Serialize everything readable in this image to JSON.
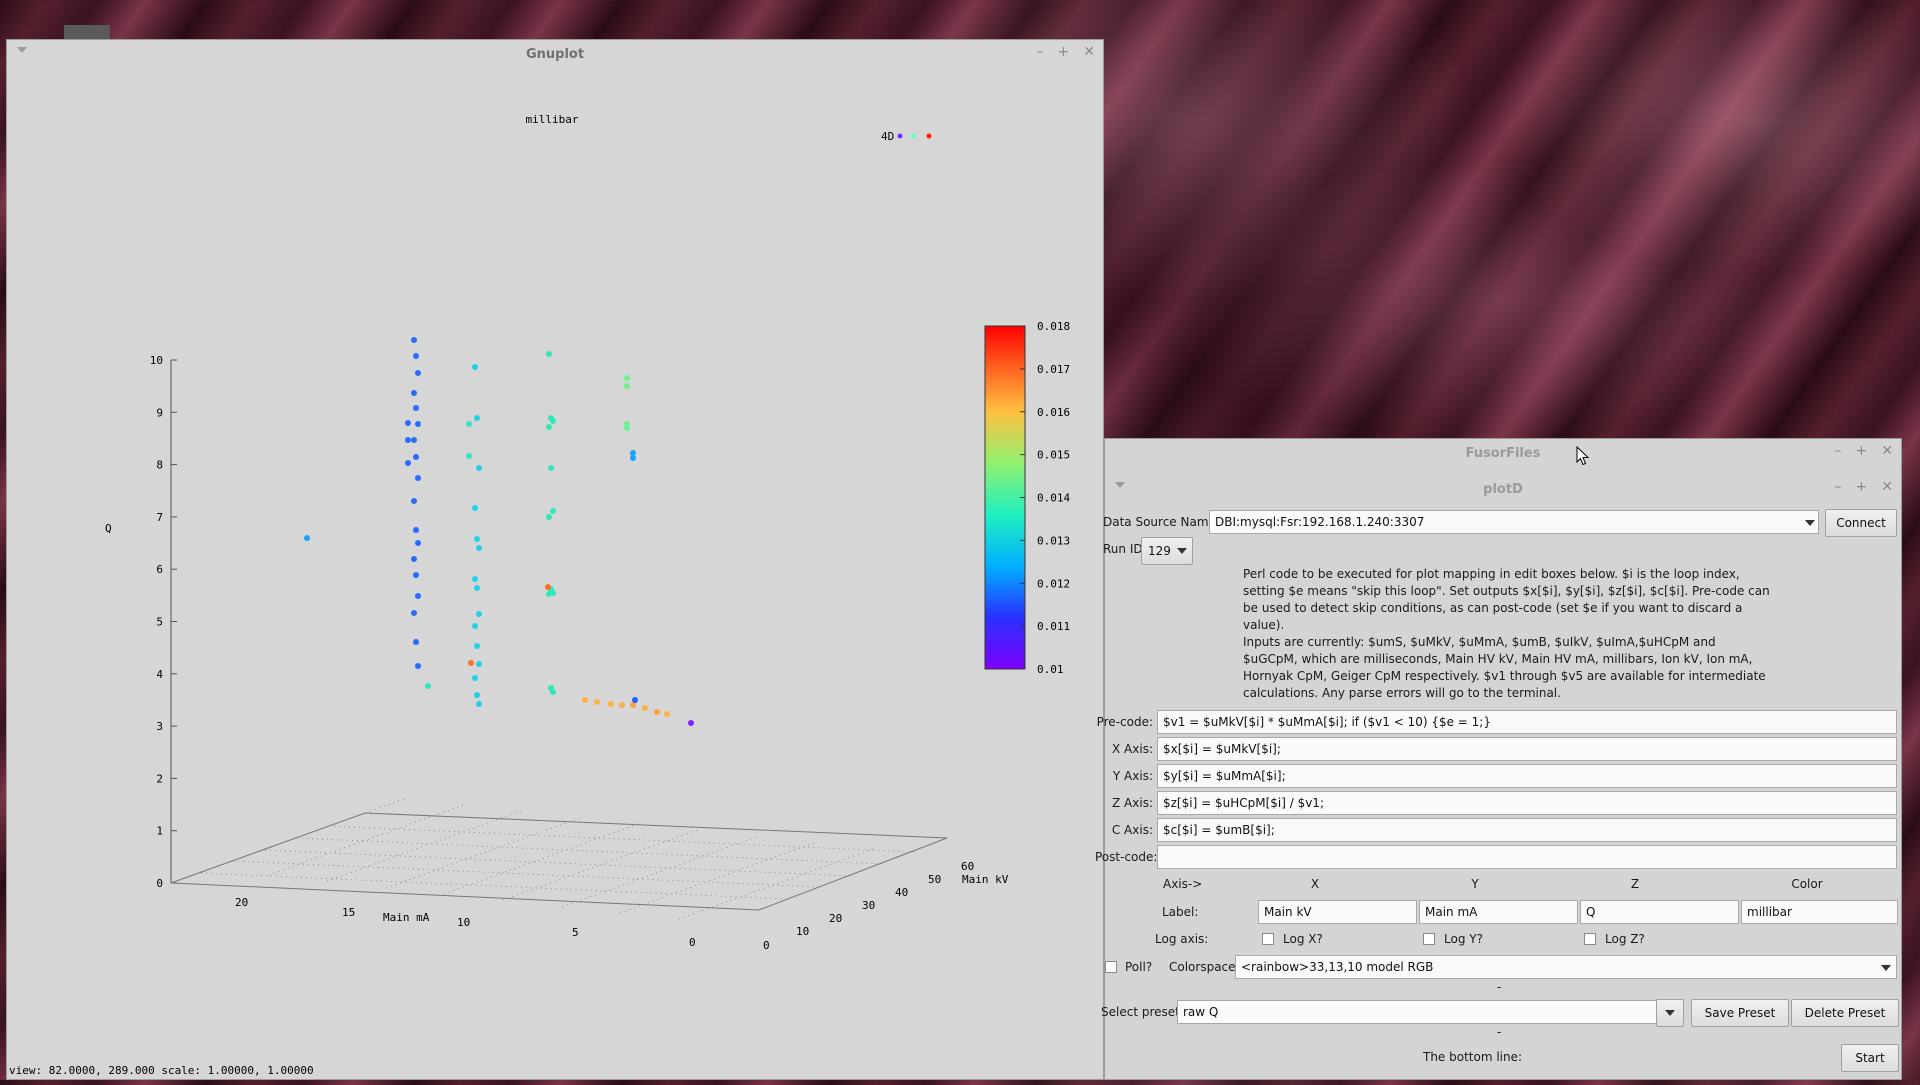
{
  "gnuplot": {
    "title": "Gnuplot",
    "plot_title": "millibar",
    "legend_label": "4D",
    "z_axis_label": "Q",
    "x_axis_label": "Main kV",
    "y_axis_label": "Main mA",
    "status": "view: 82.0000,  289.000   scale: 1.00000,  1.00000",
    "z_ticks": [
      "10",
      "9",
      "8",
      "7",
      "6",
      "5",
      "4",
      "3",
      "2",
      "1",
      "0"
    ],
    "mA_ticks": [
      "20",
      "15",
      "10",
      "5",
      "0"
    ],
    "kV_ticks": [
      "0",
      "10",
      "20",
      "30",
      "40",
      "50",
      "60"
    ],
    "colorbar_ticks": [
      "0.018",
      "0.017",
      "0.016",
      "0.015",
      "0.014",
      "0.013",
      "0.012",
      "0.011",
      "0.01"
    ]
  },
  "fusor": {
    "title": "FusorFiles"
  },
  "plotd": {
    "title": "plotD",
    "data_source_label": "Data Source Name:",
    "data_source_value": "DBI:mysql:Fsr:192.168.1.240:3307",
    "connect_label": "Connect",
    "run_id_label": "Run ID:",
    "run_id_value": "129",
    "help1": "Perl code to be executed for plot mapping in edit boxes below.  $i is the loop index, setting $e means \"skip this loop\".  Set outputs $x[$i], $y[$i], $z[$i], $c[$i].  Pre-code can be used to detect skip conditions, as can post-code (set $e if you want to discard a value).",
    "help2": "Inputs are currently: $umS, $uMkV, $uMmA, $umB, $uIkV, $uImA,$uHCpM and $uGCpM, which are milliseconds, Main HV kV, Main HV mA, millibars, Ion kV, Ion mA, Hornyak CpM, Geiger CpM respectively.  $v1 through $v5 are available for intermediate calculations. Any parse errors will go to the terminal.",
    "precode_label": "Pre-code:",
    "precode_value": "$v1 = $uMkV[$i] * $uMmA[$i]; if ($v1 < 10) {$e = 1;}",
    "xaxis_label": "X Axis:",
    "xaxis_value": "$x[$i] = $uMkV[$i];",
    "yaxis_label": "Y Axis:",
    "yaxis_value": "$y[$i] = $uMmA[$i];",
    "zaxis_label": "Z Axis:",
    "zaxis_value": "$z[$i] = $uHCpM[$i] / $v1;",
    "caxis_label": "C Axis:",
    "caxis_value": "$c[$i] = $umB[$i];",
    "postcode_label": "Post-code:",
    "postcode_value": "",
    "axis_header": "Axis->",
    "col_x": "X",
    "col_y": "Y",
    "col_z": "Z",
    "col_color": "Color",
    "label_row": "Label:",
    "label_x": "Main kV",
    "label_y": "Main mA",
    "label_z": "Q",
    "label_color": "millibar",
    "log_axis_label": "Log axis:",
    "log_x": "Log X?",
    "log_y": "Log Y?",
    "log_z": "Log Z?",
    "poll_label": "Poll?",
    "colorspace_label": "Colorspace:",
    "colorspace_value": "<rainbow>33,13,10 model RGB",
    "dash1": "-",
    "preset_label": "Select preset:",
    "preset_value": "raw Q",
    "save_preset": "Save Preset",
    "delete_preset": "Delete Preset",
    "dash2": "-",
    "bottom_line_label": "The bottom line:",
    "start_label": "Start"
  }
}
